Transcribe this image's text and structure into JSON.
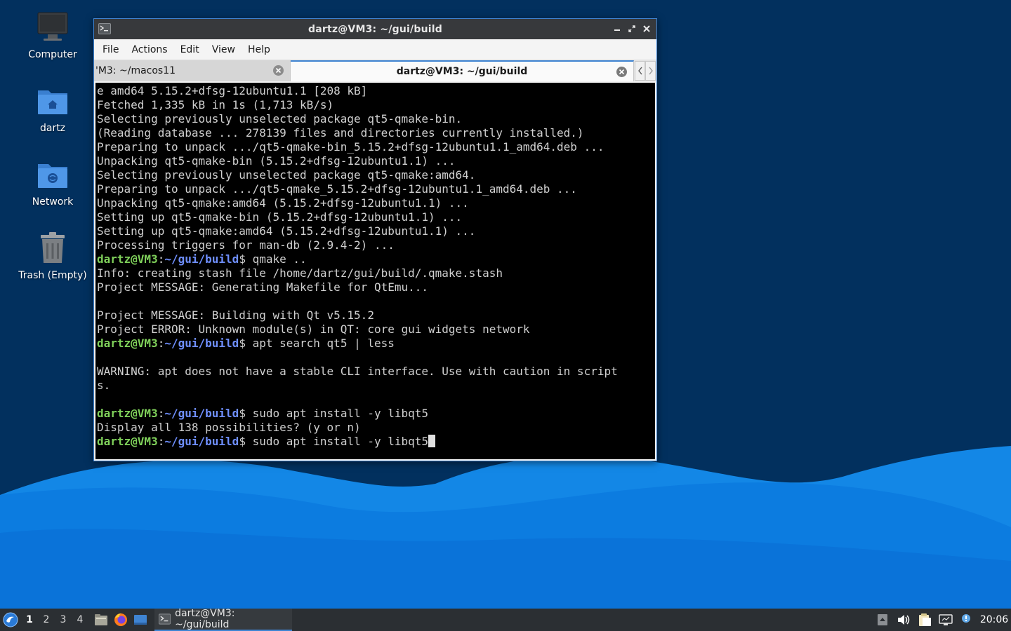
{
  "desktop": {
    "icons": [
      {
        "label": "Computer",
        "icon": "monitor-icon"
      },
      {
        "label": "dartz",
        "icon": "home-folder-icon"
      },
      {
        "label": "Network",
        "icon": "network-folder-icon"
      },
      {
        "label": "Trash (Empty)",
        "icon": "trash-icon"
      }
    ]
  },
  "window": {
    "title": "dartz@VM3: ~/gui/build",
    "menu": [
      "File",
      "Actions",
      "Edit",
      "View",
      "Help"
    ],
    "tabs": [
      {
        "label": "'M3: ~/macos11",
        "active": false
      },
      {
        "label": "dartz@VM3: ~/gui/build",
        "active": true
      }
    ],
    "prompt": {
      "user": "dartz@VM3",
      "sep": ":",
      "path": "~/gui/build",
      "dollar": "$"
    },
    "terminal_lines": [
      {
        "type": "text",
        "text": "e amd64 5.15.2+dfsg-12ubuntu1.1 [208 kB]"
      },
      {
        "type": "text",
        "text": "Fetched 1,335 kB in 1s (1,713 kB/s)"
      },
      {
        "type": "text",
        "text": "Selecting previously unselected package qt5-qmake-bin."
      },
      {
        "type": "text",
        "text": "(Reading database ... 278139 files and directories currently installed.)"
      },
      {
        "type": "text",
        "text": "Preparing to unpack .../qt5-qmake-bin_5.15.2+dfsg-12ubuntu1.1_amd64.deb ..."
      },
      {
        "type": "text",
        "text": "Unpacking qt5-qmake-bin (5.15.2+dfsg-12ubuntu1.1) ..."
      },
      {
        "type": "text",
        "text": "Selecting previously unselected package qt5-qmake:amd64."
      },
      {
        "type": "text",
        "text": "Preparing to unpack .../qt5-qmake_5.15.2+dfsg-12ubuntu1.1_amd64.deb ..."
      },
      {
        "type": "text",
        "text": "Unpacking qt5-qmake:amd64 (5.15.2+dfsg-12ubuntu1.1) ..."
      },
      {
        "type": "text",
        "text": "Setting up qt5-qmake-bin (5.15.2+dfsg-12ubuntu1.1) ..."
      },
      {
        "type": "text",
        "text": "Setting up qt5-qmake:amd64 (5.15.2+dfsg-12ubuntu1.1) ..."
      },
      {
        "type": "text",
        "text": "Processing triggers for man-db (2.9.4-2) ..."
      },
      {
        "type": "prompt",
        "cmd": " qmake .."
      },
      {
        "type": "text",
        "text": "Info: creating stash file /home/dartz/gui/build/.qmake.stash"
      },
      {
        "type": "text",
        "text": "Project MESSAGE: Generating Makefile for QtEmu..."
      },
      {
        "type": "text",
        "text": ""
      },
      {
        "type": "text",
        "text": "Project MESSAGE: Building with Qt v5.15.2"
      },
      {
        "type": "text",
        "text": "Project ERROR: Unknown module(s) in QT: core gui widgets network"
      },
      {
        "type": "prompt",
        "cmd": " apt search qt5 | less"
      },
      {
        "type": "text",
        "text": ""
      },
      {
        "type": "text",
        "text": "WARNING: apt does not have a stable CLI interface. Use with caution in script"
      },
      {
        "type": "text",
        "text": "s."
      },
      {
        "type": "text",
        "text": ""
      },
      {
        "type": "prompt",
        "cmd": " sudo apt install -y libqt5"
      },
      {
        "type": "text",
        "text": "Display all 138 possibilities? (y or n)"
      },
      {
        "type": "prompt",
        "cmd": " sudo apt install -y libqt5",
        "cursor": true
      }
    ]
  },
  "taskbar": {
    "workspaces": [
      "1",
      "2",
      "3",
      "4"
    ],
    "active_workspace": "1",
    "launchers": [
      "file-manager-icon",
      "firefox-icon",
      "desktop-icon"
    ],
    "task_label": "dartz@VM3: ~/gui/build",
    "clock": "20:06",
    "tray": [
      "tray-up-arrow-icon",
      "volume-icon",
      "clipboard-icon",
      "network-icon",
      "notification-icon"
    ]
  },
  "colors": {
    "accent": "#3f84d2",
    "prompt_user": "#7fd05a",
    "prompt_path": "#6f8fff",
    "terminal_bg": "#000000",
    "titlebar": "#37393c"
  }
}
